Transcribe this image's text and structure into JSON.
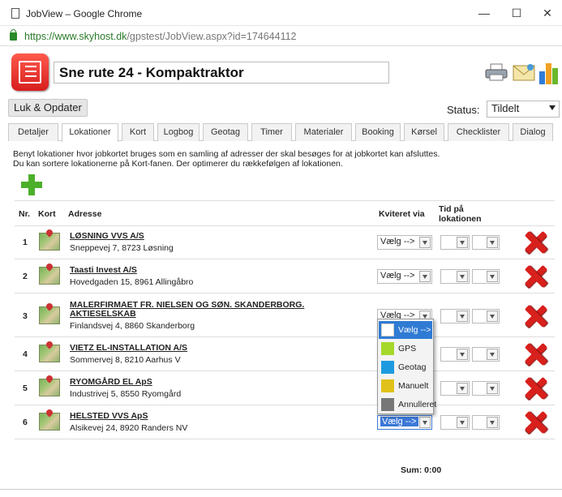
{
  "window": {
    "title": "JobView – Google Chrome",
    "minimize": "—",
    "maximize": "☐",
    "close": "✕"
  },
  "address": {
    "host": "https://www.skyhost.dk",
    "path": "/gpstest/JobView.aspx?id=174644112"
  },
  "header": {
    "job_title": "Sne rute 24 - Kompaktraktor",
    "icons": [
      "app-logo-icon",
      "printer-icon",
      "mail-icon",
      "bar-chart-icon"
    ]
  },
  "toolbar": {
    "close_update": "Luk & Opdater",
    "status_label": "Status:",
    "status_value": "Tildelt"
  },
  "tabs": [
    "Detaljer",
    "Lokationer",
    "Kort",
    "Logbog",
    "Geotag",
    "Timer",
    "Materialer",
    "Booking",
    "Kørsel",
    "Checklister",
    "Dialog"
  ],
  "active_tab": "Lokationer",
  "intro": {
    "line1": "Benyt lokationer hvor jobkortet bruges som en samling af adresser der skal besøges for at jobkortet kan afsluttes.",
    "line2": "Du kan sortere lokationerne på Kort-fanen. Der optimerer du rækkefølgen af lokationen."
  },
  "table": {
    "headers": {
      "nr": "Nr.",
      "kort": "Kort",
      "adresse": "Adresse",
      "kviteret": "Kviteret via",
      "tid_line1": "Tid på",
      "tid_line2": "lokationen"
    },
    "rows": [
      {
        "nr": "1",
        "name": "LØSNING VVS A/S",
        "name2": "",
        "address": "Sneppevej 7, 8723 Løsning",
        "select": "Vælg -->"
      },
      {
        "nr": "2",
        "name": "Taasti Invest A/S",
        "name2": "",
        "address": "Hovedgaden 15, 8961 Allingåbro",
        "select": "Vælg -->"
      },
      {
        "nr": "3",
        "name": "MALERFIRMAET FR. NIELSEN OG SØN. SKANDERBORG.",
        "name2": "AKTIESELSKAB",
        "address": "Finlandsvej 4, 8860 Skanderborg",
        "select": "Vælg -->"
      },
      {
        "nr": "4",
        "name": "VIETZ EL-INSTALLATION A/S",
        "name2": "",
        "address": "Sommervej 8, 8210 Aarhus V",
        "select": "Vælg -->"
      },
      {
        "nr": "5",
        "name": "RYOMGÅRD EL ApS",
        "name2": "",
        "address": "Industrivej 5, 8550 Ryomgård",
        "select": "Vælg -->"
      },
      {
        "nr": "6",
        "name": "HELSTED VVS ApS",
        "name2": "",
        "address": "Alsikevej 24, 8920 Randers NV",
        "select": "Vælg -->"
      }
    ],
    "sum": "Sum: 0:00"
  },
  "dropdown": {
    "options": [
      {
        "label": "Vælg -->",
        "color": "#ffffff"
      },
      {
        "label": "GPS",
        "color": "#a6d82c"
      },
      {
        "label": "Geotag",
        "color": "#1e9be0"
      },
      {
        "label": "Manuelt",
        "color": "#e0c21a"
      },
      {
        "label": "Annulleret",
        "color": "#777777"
      }
    ]
  }
}
